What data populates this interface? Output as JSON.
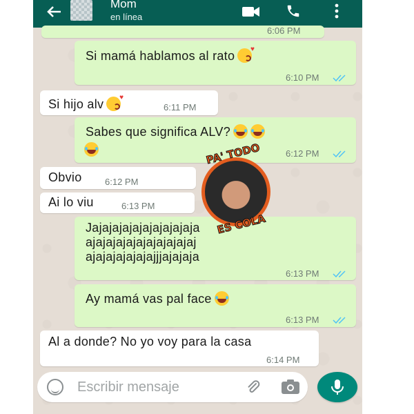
{
  "header": {
    "contact_name": "Mom",
    "status": "en línea"
  },
  "messages": [
    {
      "direction": "out",
      "text": "",
      "time": "6:06 PM",
      "read": false
    },
    {
      "direction": "out",
      "text": "Si mamá hablamos al rato",
      "emoji": [
        "kiss"
      ],
      "time": "6:10 PM",
      "read": true
    },
    {
      "direction": "in",
      "text": "Si hijo alv",
      "emoji": [
        "kiss"
      ],
      "time": "6:11 PM"
    },
    {
      "direction": "out",
      "text": "Sabes que significa ALV?",
      "emoji": [
        "laugh",
        "laugh",
        "laugh"
      ],
      "time": "6:12 PM",
      "read": true
    },
    {
      "direction": "in",
      "text": "Obvio",
      "time": "6:12 PM"
    },
    {
      "direction": "in",
      "text": "Ai lo viu",
      "time": "6:13 PM"
    },
    {
      "direction": "out",
      "lines": [
        "Jajajajajajajajajajaja",
        "ajajajajajajajajajajaj",
        "ajajajajajajajjjajajaja"
      ],
      "time": "6:13 PM",
      "read": true
    },
    {
      "direction": "out",
      "text": "Ay mamá vas pal face",
      "emoji": [
        "laugh"
      ],
      "time": "6:13 PM",
      "read": true
    },
    {
      "direction": "in",
      "text": "Al a donde? No yo voy para la casa",
      "time": "6:14 PM"
    }
  ],
  "watermark": {
    "top_text": "PA' TODO",
    "bottom_text": "ES COLA"
  },
  "input": {
    "placeholder": "Escribir mensaje"
  },
  "colors": {
    "header": "#075e54",
    "outgoing_bubble": "#dcf8c6",
    "incoming_bubble": "#ffffff",
    "chat_background": "#e5ddd5",
    "read_ticks": "#4fc3f7",
    "mic_button": "#00897b"
  },
  "icons": {
    "back": "arrow-left-icon",
    "video": "video-camera-icon",
    "call": "phone-icon",
    "menu": "more-vertical-icon",
    "emoji": "smiley-icon",
    "attach": "paperclip-icon",
    "camera": "camera-icon",
    "mic": "microphone-icon"
  }
}
